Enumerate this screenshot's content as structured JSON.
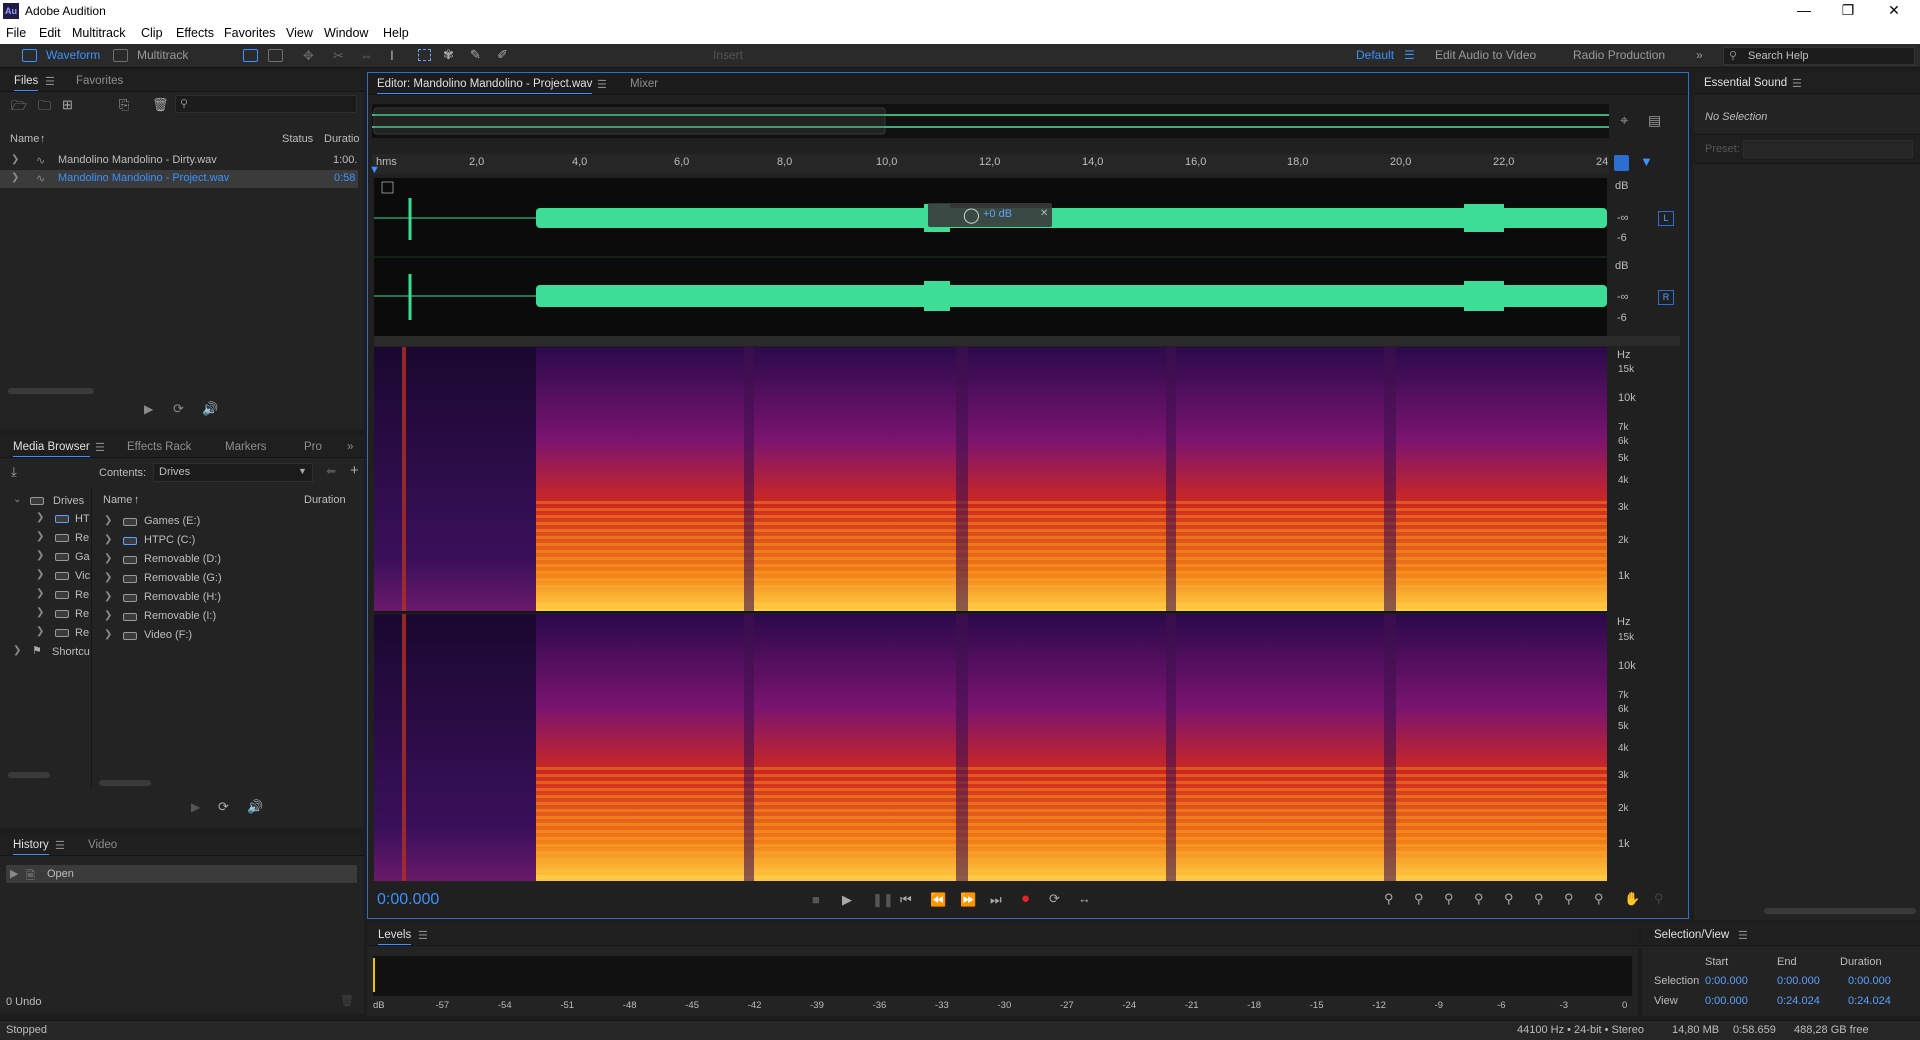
{
  "app": {
    "title": "Adobe Audition",
    "logo": "Au"
  },
  "menu": [
    "File",
    "Edit",
    "Multitrack",
    "Clip",
    "Effects",
    "Favorites",
    "View",
    "Window",
    "Help"
  ],
  "toolbar": {
    "waveform": "Waveform",
    "multitrack": "Multitrack",
    "insert": "Insert",
    "workspaces": [
      "Default",
      "Edit Audio to Video",
      "Radio Production"
    ],
    "search_placeholder": "Search Help"
  },
  "files_panel": {
    "tabs": [
      "Files",
      "Favorites"
    ],
    "columns": {
      "name": "Name",
      "status": "Status",
      "duration": "Duratio"
    },
    "rows": [
      {
        "name": "Mandolino Mandolino - Dirty.wav",
        "duration": "1:00."
      },
      {
        "name": "Mandolino Mandolino - Project.wav",
        "duration": "0:58"
      }
    ]
  },
  "media_panel": {
    "tabs": [
      "Media Browser",
      "Effects Rack",
      "Markers",
      "Pro"
    ],
    "contents_label": "Contents:",
    "contents_value": "Drives",
    "tree": [
      "Drives",
      "HT",
      "Re",
      "Ga",
      "Vic",
      "Re",
      "Re",
      "Re",
      "Shortcu"
    ],
    "columns": {
      "name": "Name",
      "duration": "Duration"
    },
    "drives": [
      "Games (E:)",
      "HTPC (C:)",
      "Removable (D:)",
      "Removable (G:)",
      "Removable (H:)",
      "Removable (I:)",
      "Video (F:)"
    ]
  },
  "history_panel": {
    "tabs": [
      "History",
      "Video"
    ],
    "items": [
      "Open"
    ],
    "undo": "0 Undo"
  },
  "editor": {
    "tab": "Editor: Mandolino Mandolino - Project.wav",
    "mixer_tab": "Mixer",
    "ruler_unit": "hms",
    "ruler_ticks": [
      "2,0",
      "4,0",
      "6,0",
      "8,0",
      "10,0",
      "12,0",
      "14,0",
      "16,0",
      "18,0",
      "20,0",
      "22,0",
      "24"
    ],
    "db_label": "dB",
    "db_inf": "-∞",
    "db_minus6": "-6",
    "channel_L": "L",
    "channel_R": "R",
    "hud_gain": "+0 dB",
    "hz_label": "Hz",
    "hz_ticks": [
      "15k",
      "10k",
      "7k",
      "6k",
      "5k",
      "4k",
      "3k",
      "2k",
      "1k"
    ],
    "time": "0:00.000"
  },
  "levels": {
    "title": "Levels",
    "scale": [
      "dB",
      "-57",
      "-54",
      "-51",
      "-48",
      "-45",
      "-42",
      "-39",
      "-36",
      "-33",
      "-30",
      "-27",
      "-24",
      "-21",
      "-18",
      "-15",
      "-12",
      "-9",
      "-6",
      "-3",
      "0"
    ]
  },
  "essential_sound": {
    "title": "Essential Sound",
    "no_selection": "No Selection",
    "preset_label": "Preset:"
  },
  "selection_view": {
    "title": "Selection/View",
    "headers": [
      "Start",
      "End",
      "Duration"
    ],
    "rows": [
      {
        "label": "Selection",
        "start": "0:00.000",
        "end": "0:00.000",
        "duration": "0:00.000"
      },
      {
        "label": "View",
        "start": "0:00.000",
        "end": "0:24.024",
        "duration": "0:24.024"
      }
    ]
  },
  "status": {
    "state": "Stopped",
    "format": "44100 Hz • 24-bit • Stereo",
    "size": "14,80 MB",
    "duration": "0:58.659",
    "free": "488,28 GB free"
  },
  "colors": {
    "accent": "#3a91ff",
    "waveform": "#3ddc97",
    "record": "#e0262b"
  }
}
